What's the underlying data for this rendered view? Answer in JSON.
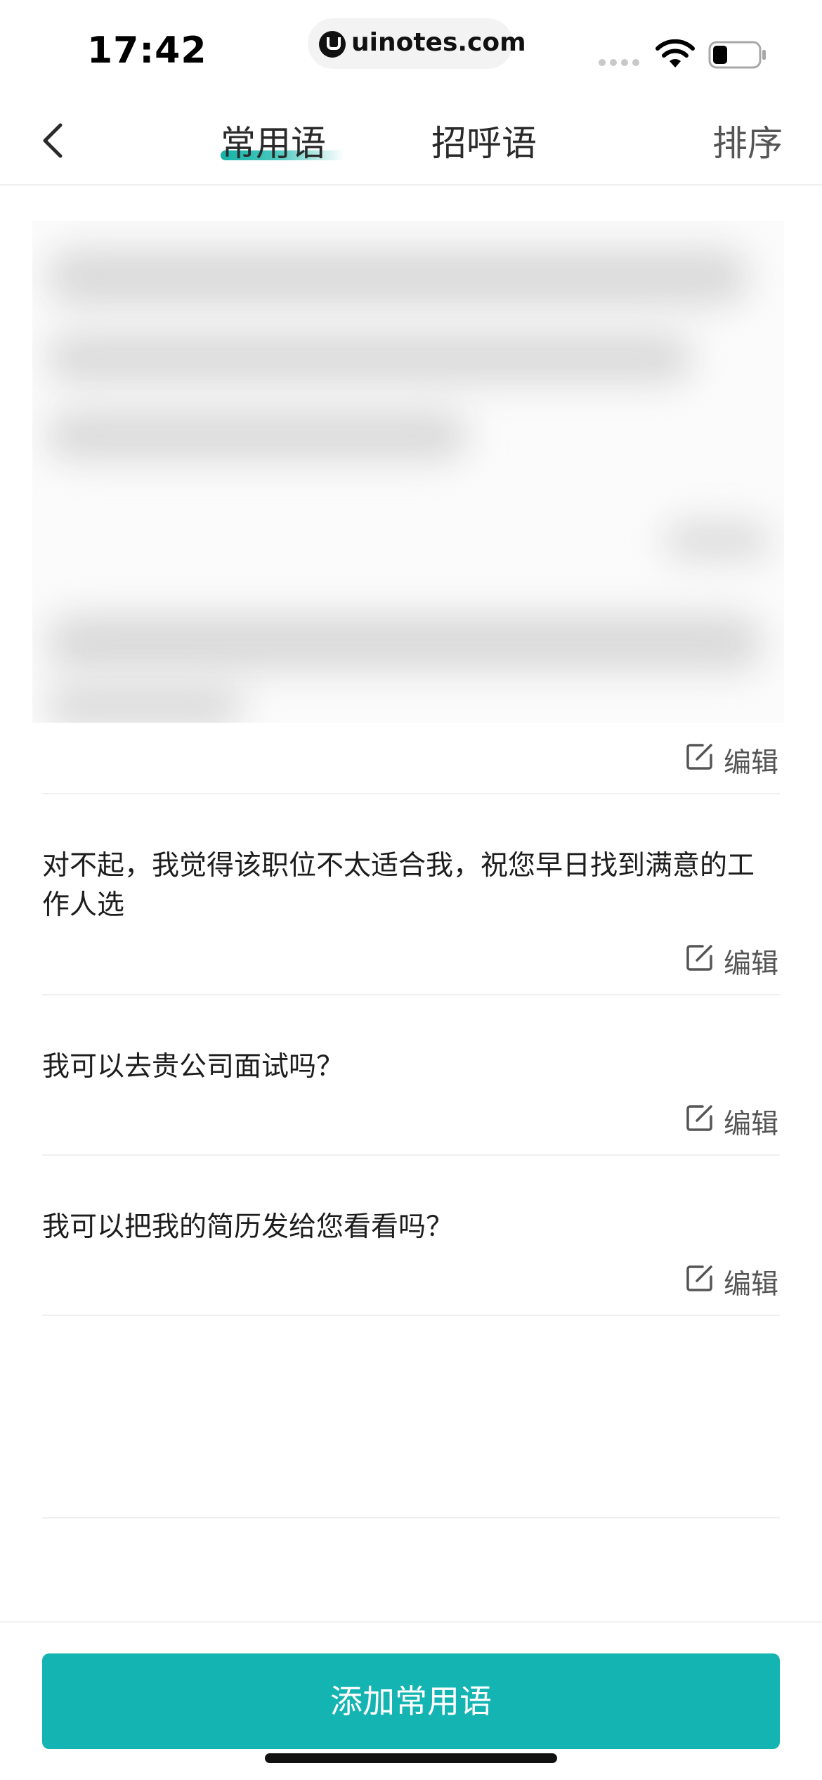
{
  "status_bar": {
    "time": "17:42",
    "url": "uinotes.com",
    "icons": [
      "signal-icon",
      "wifi-icon",
      "battery-icon"
    ]
  },
  "nav": {
    "back_icon": "chevron-left-icon",
    "tabs": [
      {
        "label": "常用语",
        "active": true
      },
      {
        "label": "招呼语",
        "active": false
      }
    ],
    "sort_label": "排序"
  },
  "phrases": [
    {
      "text": "",
      "blurred": true,
      "edit_label": "编辑"
    },
    {
      "text": "对不起，我觉得该职位不太适合我，祝您早日找到满意的工作人选",
      "edit_label": "编辑"
    },
    {
      "text": "我可以去贵公司面试吗？",
      "edit_label": "编辑"
    },
    {
      "text": "我可以把我的简历发给您看看吗？",
      "edit_label": "编辑"
    }
  ],
  "add_button_label": "添加常用语",
  "colors": {
    "accent": "#14b4b2",
    "text": "#1d1d1d",
    "secondary_text": "#555555",
    "divider": "#f0f0f0"
  }
}
